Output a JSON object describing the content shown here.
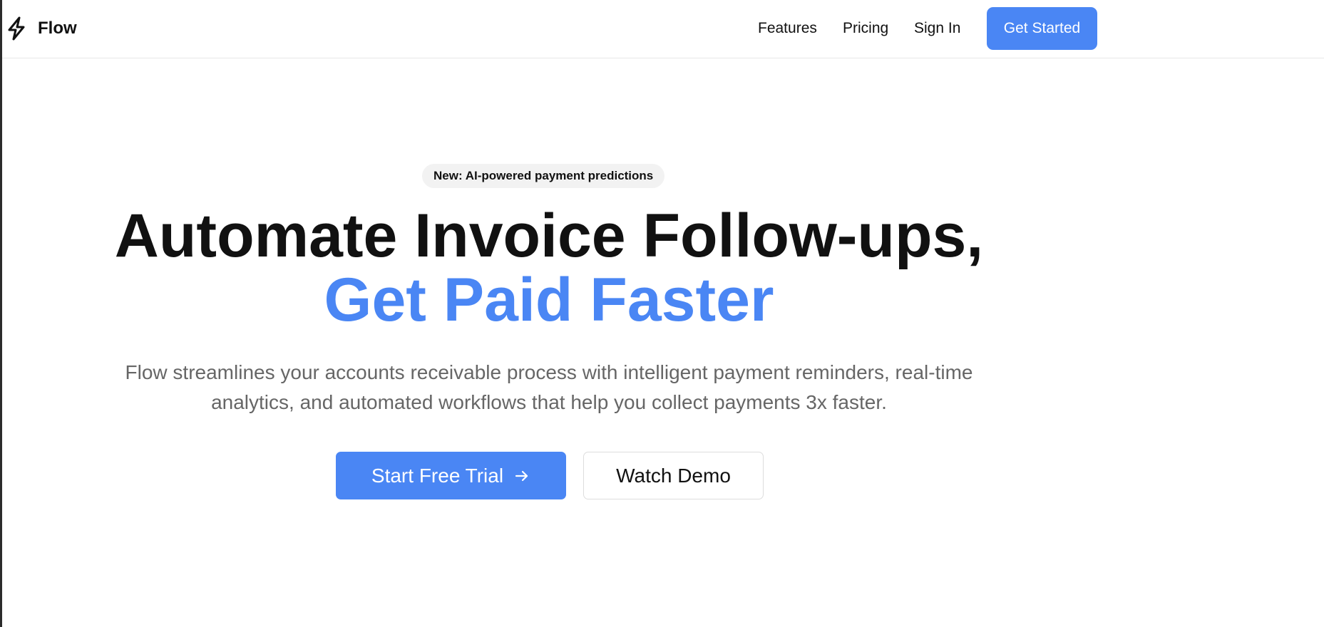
{
  "brand": {
    "name": "Flow",
    "icon": "lightning-icon"
  },
  "nav": {
    "items": [
      {
        "label": "Features"
      },
      {
        "label": "Pricing"
      },
      {
        "label": "Sign In"
      }
    ],
    "cta_label": "Get Started"
  },
  "hero": {
    "badge": "New: AI-powered payment predictions",
    "headline_line1": "Automate Invoice Follow-ups,",
    "headline_line2": "Get Paid Faster",
    "subtitle_line1": "Flow streamlines your accounts receivable process with intelligent payment reminders, real-time",
    "subtitle_line2": "analytics, and automated workflows that help you collect payments 3x faster.",
    "primary_cta_label": "Start Free Trial",
    "primary_cta_icon": "arrow-right-icon",
    "secondary_cta_label": "Watch Demo"
  },
  "colors": {
    "accent": "#4a86f4",
    "text": "#111111",
    "muted_text": "#666666",
    "badge_bg": "#f2f2f2",
    "border": "#e8e8e8"
  }
}
